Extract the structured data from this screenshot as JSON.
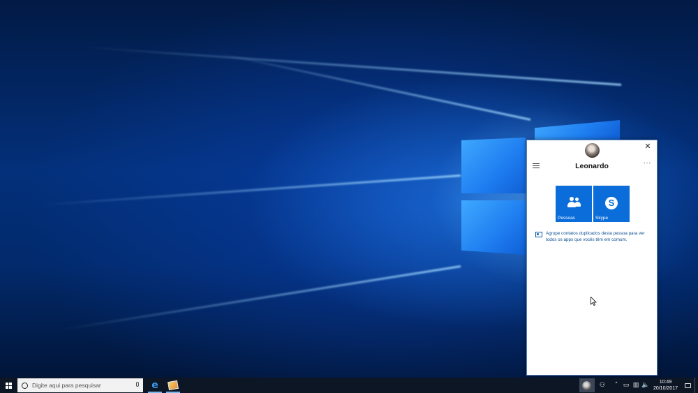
{
  "taskbar": {
    "search_placeholder": "Digite aqui para pesquisar",
    "time": "10:49",
    "date": "20/10/2017",
    "tray_icons": [
      "people-icon",
      "chevron-up-icon",
      "battery-icon",
      "network-icon",
      "volume-icon"
    ]
  },
  "flyout": {
    "contact_name": "Leonardo",
    "close_glyph": "✕",
    "more_glyph": "···",
    "tiles": [
      {
        "label": "Pessoas",
        "icon": "people-icon"
      },
      {
        "label": "Skype",
        "icon": "skype-icon"
      }
    ],
    "link_text": "Agrupe contatos duplicados desta pessoa para ver todos os apps que vocês têm em comum.",
    "accent_color": "#0a6dd9"
  }
}
